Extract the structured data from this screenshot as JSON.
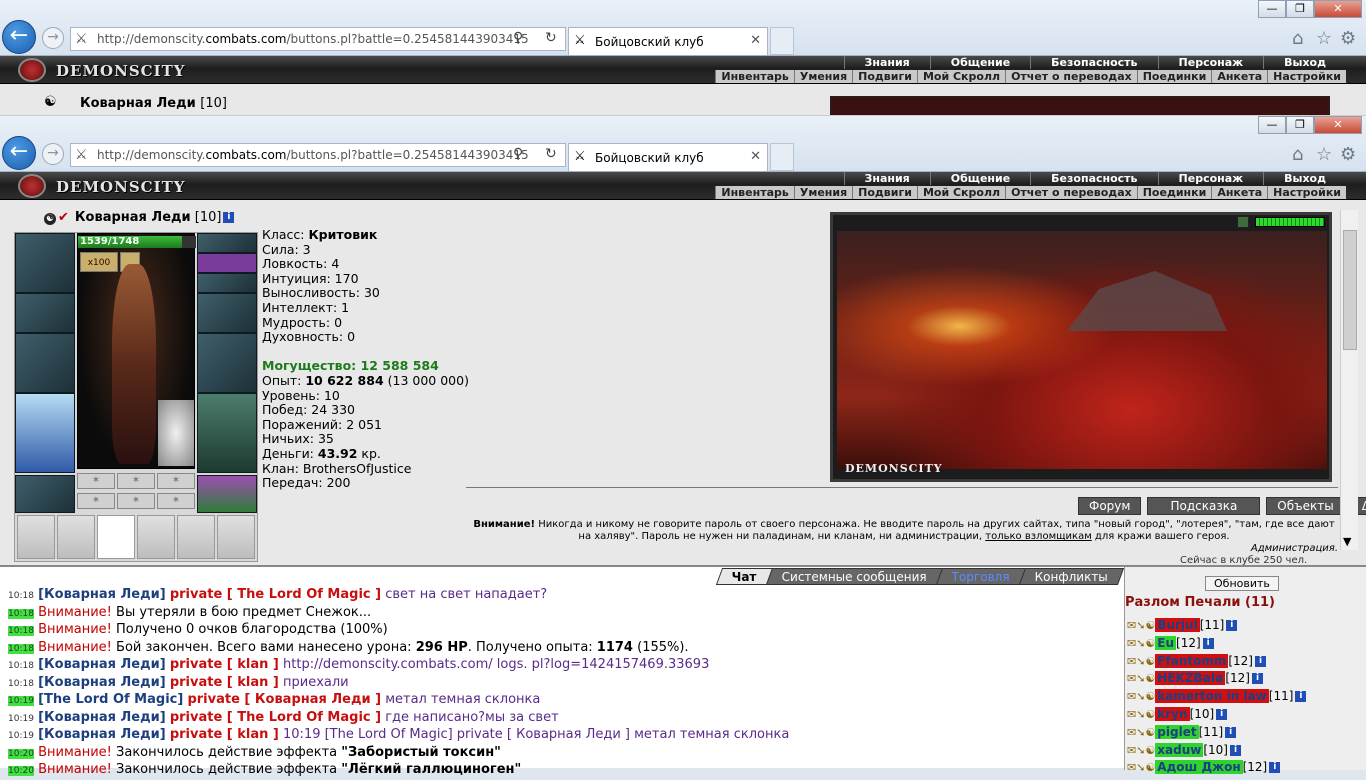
{
  "browser": {
    "url_prefix": "http://demonscity.",
    "url_domain": "combats.com",
    "url_suffix": "/buttons.pl?battle=0.254581443903415",
    "tab_title": "Бойцовский клуб",
    "back_glyph": "←",
    "fwd_glyph": "→",
    "favicon": "⚔",
    "search_glyph": "⚲",
    "refresh_glyph": "↻",
    "close_glyph": "✕",
    "home_glyph": "⌂",
    "star_glyph": "☆",
    "gear_glyph": "⚙",
    "min_glyph": "—",
    "max_glyph": "❐",
    "wclose_glyph": "✕"
  },
  "game": {
    "brand": "DEMONSCITY",
    "menu_main": [
      "Знания",
      "Общение",
      "Безопасность",
      "Персонаж",
      "Выход"
    ],
    "menu_sub": [
      "Инвентарь",
      "Умения",
      "Подвиги",
      "Мой Скролл",
      "Отчет о переводах",
      "Поединки",
      "Анкета",
      "Настройки"
    ]
  },
  "character": {
    "name": "Коварная Леди",
    "level": "[10]",
    "info_glyph": "i",
    "hp_text": "1539/1748",
    "hp_fraction": 0.88,
    "buff_count": "x100",
    "class_label": "Класс:",
    "class_value": "Критовик",
    "stats": [
      "Сила: 3",
      "Ловкость: 4",
      "Интуиция: 170",
      "Выносливость: 30",
      "Интеллект: 1",
      "Мудрость: 0",
      "Духовность: 0"
    ],
    "might": "Могущество: 12 588 584",
    "exp_label": "Опыт:",
    "exp_value": "10 622 884",
    "exp_next": "(13 000 000)",
    "info": [
      "Уровень: 10",
      "Побед: 24 330",
      "Поражений: 2 051",
      "Ничьих: 35"
    ],
    "money_label": "Деньги:",
    "money_value": "43.92",
    "money_unit": "кр.",
    "clan": "Клан: BrothersOfJustice",
    "transfers": "Передач: 200"
  },
  "location": {
    "caption": "DEMONSCITY",
    "buttons": [
      "Форум",
      "Подсказка",
      "Объекты",
      "Δ"
    ]
  },
  "warning": {
    "bold": "Внимание!",
    "text": " Никогда и никому не говорите пароль от своего персонажа. Не вводите пароль на других сайтах, типа \"новый город\", \"лотерея\", \"там, где все дают на халяву\". Пароль не нужен ни паладинам, ни кланам, ни администрации, ",
    "link": "только взломщикам",
    "tail": " для кражи вашего героя.",
    "signature": "Администрация.",
    "online": "Сейчас в клубе 250 чел."
  },
  "chat": {
    "tabs": [
      "Чат",
      "Системные сообщения",
      "Торговля",
      "Конфликты"
    ],
    "lines": [
      {
        "ts": "10:18",
        "hl": false,
        "nick": "Коварная Леди",
        "priv": "private [ The Lord Of Magic ]",
        "text": "свет на свет нападает?",
        "kind": "msg"
      },
      {
        "ts": "10:18",
        "hl": true,
        "sys": "Внимание!",
        "text": "Вы утеряли в бою предмет Снежок...",
        "kind": "plain"
      },
      {
        "ts": "10:18",
        "hl": true,
        "sys": "Внимание!",
        "text": "Получено 0 очков благородства (100%)",
        "kind": "plain"
      },
      {
        "ts": "10:18",
        "hl": true,
        "sys": "Внимание!",
        "text": "Бой закончен. Всего вами нанесено урона: ",
        "b1": "296 HP",
        "text2": ". Получено опыта: ",
        "b2": "1174",
        "text3": " (155%).",
        "kind": "rich"
      },
      {
        "ts": "10:18",
        "hl": false,
        "nick": "Коварная Леди",
        "priv": "private [ klan ]",
        "text": "http://demonscity.combats.com/ logs. pl?log=1424157469.33693",
        "kind": "msg"
      },
      {
        "ts": "10:18",
        "hl": false,
        "nick": "Коварная Леди",
        "priv": "private [ klan ]",
        "text": "приехали",
        "kind": "msg"
      },
      {
        "ts": "10:19",
        "hl": true,
        "nick": "The Lord Of Magic",
        "priv": "private [ Коварная Леди ]",
        "text": "метал темная склонка",
        "kind": "msg"
      },
      {
        "ts": "10:19",
        "hl": false,
        "nick": "Коварная Леди",
        "priv": "private [ The Lord Of Magic ]",
        "text": "где написано?мы за свет",
        "kind": "msg"
      },
      {
        "ts": "10:19",
        "hl": false,
        "nick": "Коварная Леди",
        "priv": "private [ klan ]",
        "text": "10:19 [The Lord Of Magic] private [ Коварная Леди ] метал темная склонка",
        "kind": "msg"
      },
      {
        "ts": "10:20",
        "hl": true,
        "sys": "Внимание!",
        "text": "Закончилось действие эффекта ",
        "b1": "\"Забористый токсин\"",
        "kind": "rich"
      },
      {
        "ts": "10:20",
        "hl": true,
        "sys": "Внимание!",
        "text": "Закончилось действие эффекта ",
        "b1": "\"Лёгкий галлюциноген\"",
        "kind": "rich"
      }
    ]
  },
  "userlist": {
    "refresh": "Обновить",
    "room": "Разлом Печали (11)",
    "users": [
      {
        "name": "Burjul",
        "lvl": "[11]",
        "bg": "red"
      },
      {
        "name": "Eu",
        "lvl": "[12]",
        "bg": "grn"
      },
      {
        "name": "Ffantomm",
        "lvl": "[12]",
        "bg": "red"
      },
      {
        "name": "HEKZBaIa",
        "lvl": "[12]",
        "bg": "red"
      },
      {
        "name": "kamerton in law",
        "lvl": "[11]",
        "bg": "red"
      },
      {
        "name": "kryn",
        "lvl": "[10]",
        "bg": "red"
      },
      {
        "name": "piglet",
        "lvl": "[11]",
        "bg": "grn"
      },
      {
        "name": "xaduw",
        "lvl": "[10]",
        "bg": "grn"
      },
      {
        "name": "Адош Джон",
        "lvl": "[12]",
        "bg": "grn"
      }
    ]
  }
}
